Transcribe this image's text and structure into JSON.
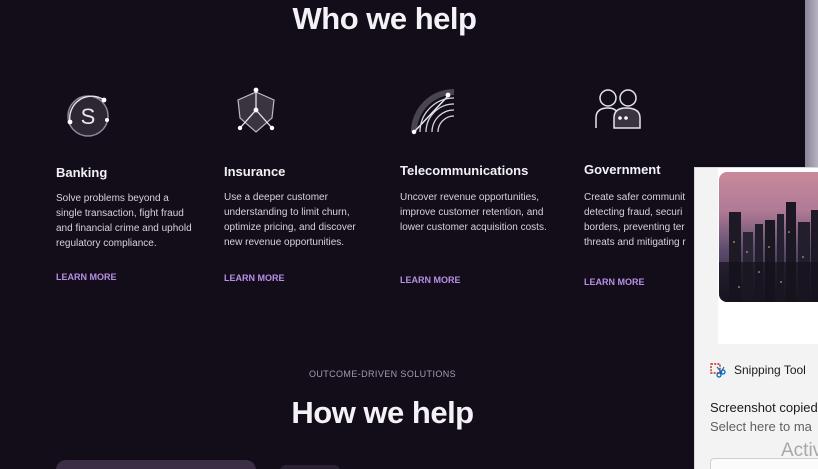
{
  "who": {
    "title": "Who we help",
    "cards": [
      {
        "icon": "banking-icon",
        "title": "Banking",
        "desc": "Solve problems beyond a single transaction, fight fraud and financial crime and uphold regulatory compliance.",
        "link": "LEARN MORE"
      },
      {
        "icon": "shield-icon",
        "title": "Insurance",
        "desc": "Use a deeper customer understanding to limit churn, optimize pricing, and discover new revenue opportunities.",
        "link": "LEARN MORE"
      },
      {
        "icon": "signal-icon",
        "title": "Telecommunications",
        "desc": "Uncover revenue opportunities, improve customer retention, and lower customer acquisition costs.",
        "link": "LEARN MORE"
      },
      {
        "icon": "people-icon",
        "title": "Government",
        "desc": "Create safer communit detecting fraud, securi borders, preventing ter threats and mitigating r",
        "link": "LEARN MORE"
      }
    ]
  },
  "how": {
    "eyebrow": "OUTCOME-DRIVEN SOLUTIONS",
    "title": "How we help"
  },
  "toast": {
    "app_name": "Snipping Tool",
    "message": "Screenshot copied",
    "sub": "Select here to ma",
    "watermark": "Activ"
  },
  "colors": {
    "background": "#120d18",
    "accent": "#b78fe6",
    "toast_bg": "#f3f3f3"
  }
}
